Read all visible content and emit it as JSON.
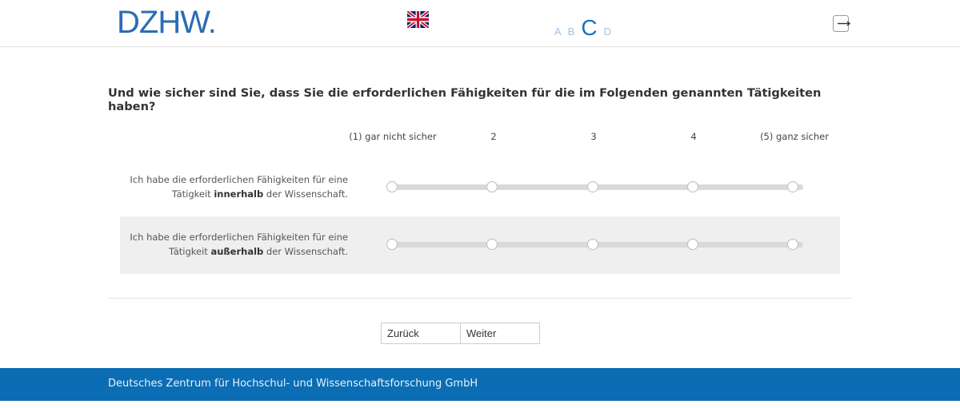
{
  "header": {
    "logo_text": "DZHW",
    "logo_dot": ".",
    "language_flag": "uk-flag-icon",
    "variants": [
      {
        "label": "A",
        "active": false
      },
      {
        "label": "B",
        "active": false
      },
      {
        "label": "C",
        "active": true
      },
      {
        "label": "D",
        "active": false
      }
    ],
    "exit_icon": "exit-icon"
  },
  "question": {
    "text": "Und wie sicher sind Sie, dass Sie die erforderlichen Fähigkeiten für die im Folgenden genannten Tätigkeiten haben?"
  },
  "scale": {
    "labels": [
      "(1) gar nicht sicher",
      "2",
      "3",
      "4",
      "(5) ganz sicher"
    ]
  },
  "items": [
    {
      "text_before": "Ich habe die erforderlichen Fähigkeiten für eine Tätigkeit ",
      "emphasis": "innerhalb",
      "text_after": " der Wissenschaft.",
      "selected": null
    },
    {
      "text_before": "Ich habe die erforderlichen Fähigkeiten für eine Tätigkeit ",
      "emphasis": "außerhalb",
      "text_after": " der Wissenschaft.",
      "selected": null
    }
  ],
  "navigation": {
    "back_label": "Zurück",
    "next_label": "Weiter"
  },
  "footer": {
    "text": "Deutsches Zentrum für Hochschul- und Wissenschaftsforschung GmbH"
  },
  "colors": {
    "brand_blue": "#2a6db5",
    "footer_blue": "#0b6db3",
    "variant_inactive": "#9ec3e6",
    "variant_active": "#1f6db8"
  }
}
